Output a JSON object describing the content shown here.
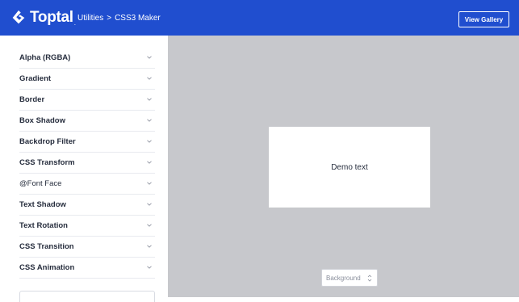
{
  "header": {
    "logo_text": "Toptal",
    "logo_dot": ".",
    "breadcrumb_parent": "Utilities",
    "breadcrumb_sep": ">",
    "breadcrumb_current": "CSS3 Maker",
    "view_gallery_label": "View Gallery",
    "bg_color": "#204ecf"
  },
  "sidebar": {
    "items": [
      {
        "label": "Alpha (RGBA)"
      },
      {
        "label": "Gradient"
      },
      {
        "label": "Border"
      },
      {
        "label": "Box Shadow"
      },
      {
        "label": "Backdrop Filter"
      },
      {
        "label": "CSS Transform"
      },
      {
        "label": "@Font Face"
      },
      {
        "label": "Text Shadow"
      },
      {
        "label": "Text Rotation"
      },
      {
        "label": "CSS Transition"
      },
      {
        "label": "CSS Animation"
      }
    ]
  },
  "canvas": {
    "demo_text": "Demo text",
    "bg_select_value": "Background",
    "bg_color": "#c7c8cc"
  },
  "icons": {
    "accordion_chevron": "chevron-down-icon",
    "select_arrows": "up-down-arrows-icon",
    "logo": "toptal-logo-icon"
  }
}
